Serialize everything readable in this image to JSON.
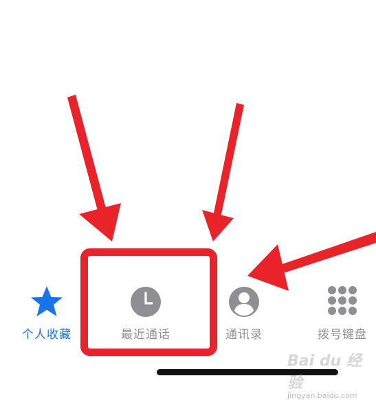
{
  "colors": {
    "active_tab": "#1a73e8",
    "inactive_tab": "#8e8e93",
    "annotation_red": "#e8232a"
  },
  "tabbar": {
    "tabs": [
      {
        "label": "个人收藏",
        "icon": "star-icon",
        "active": true
      },
      {
        "label": "最近通话",
        "icon": "clock-icon",
        "active": false
      },
      {
        "label": "通讯录",
        "icon": "person-icon",
        "active": false
      },
      {
        "label": "拨号键盘",
        "icon": "keypad-icon",
        "active": false
      }
    ]
  },
  "watermark": {
    "logo": "Bai du 经验",
    "url": "jingyan.baidu.com"
  }
}
